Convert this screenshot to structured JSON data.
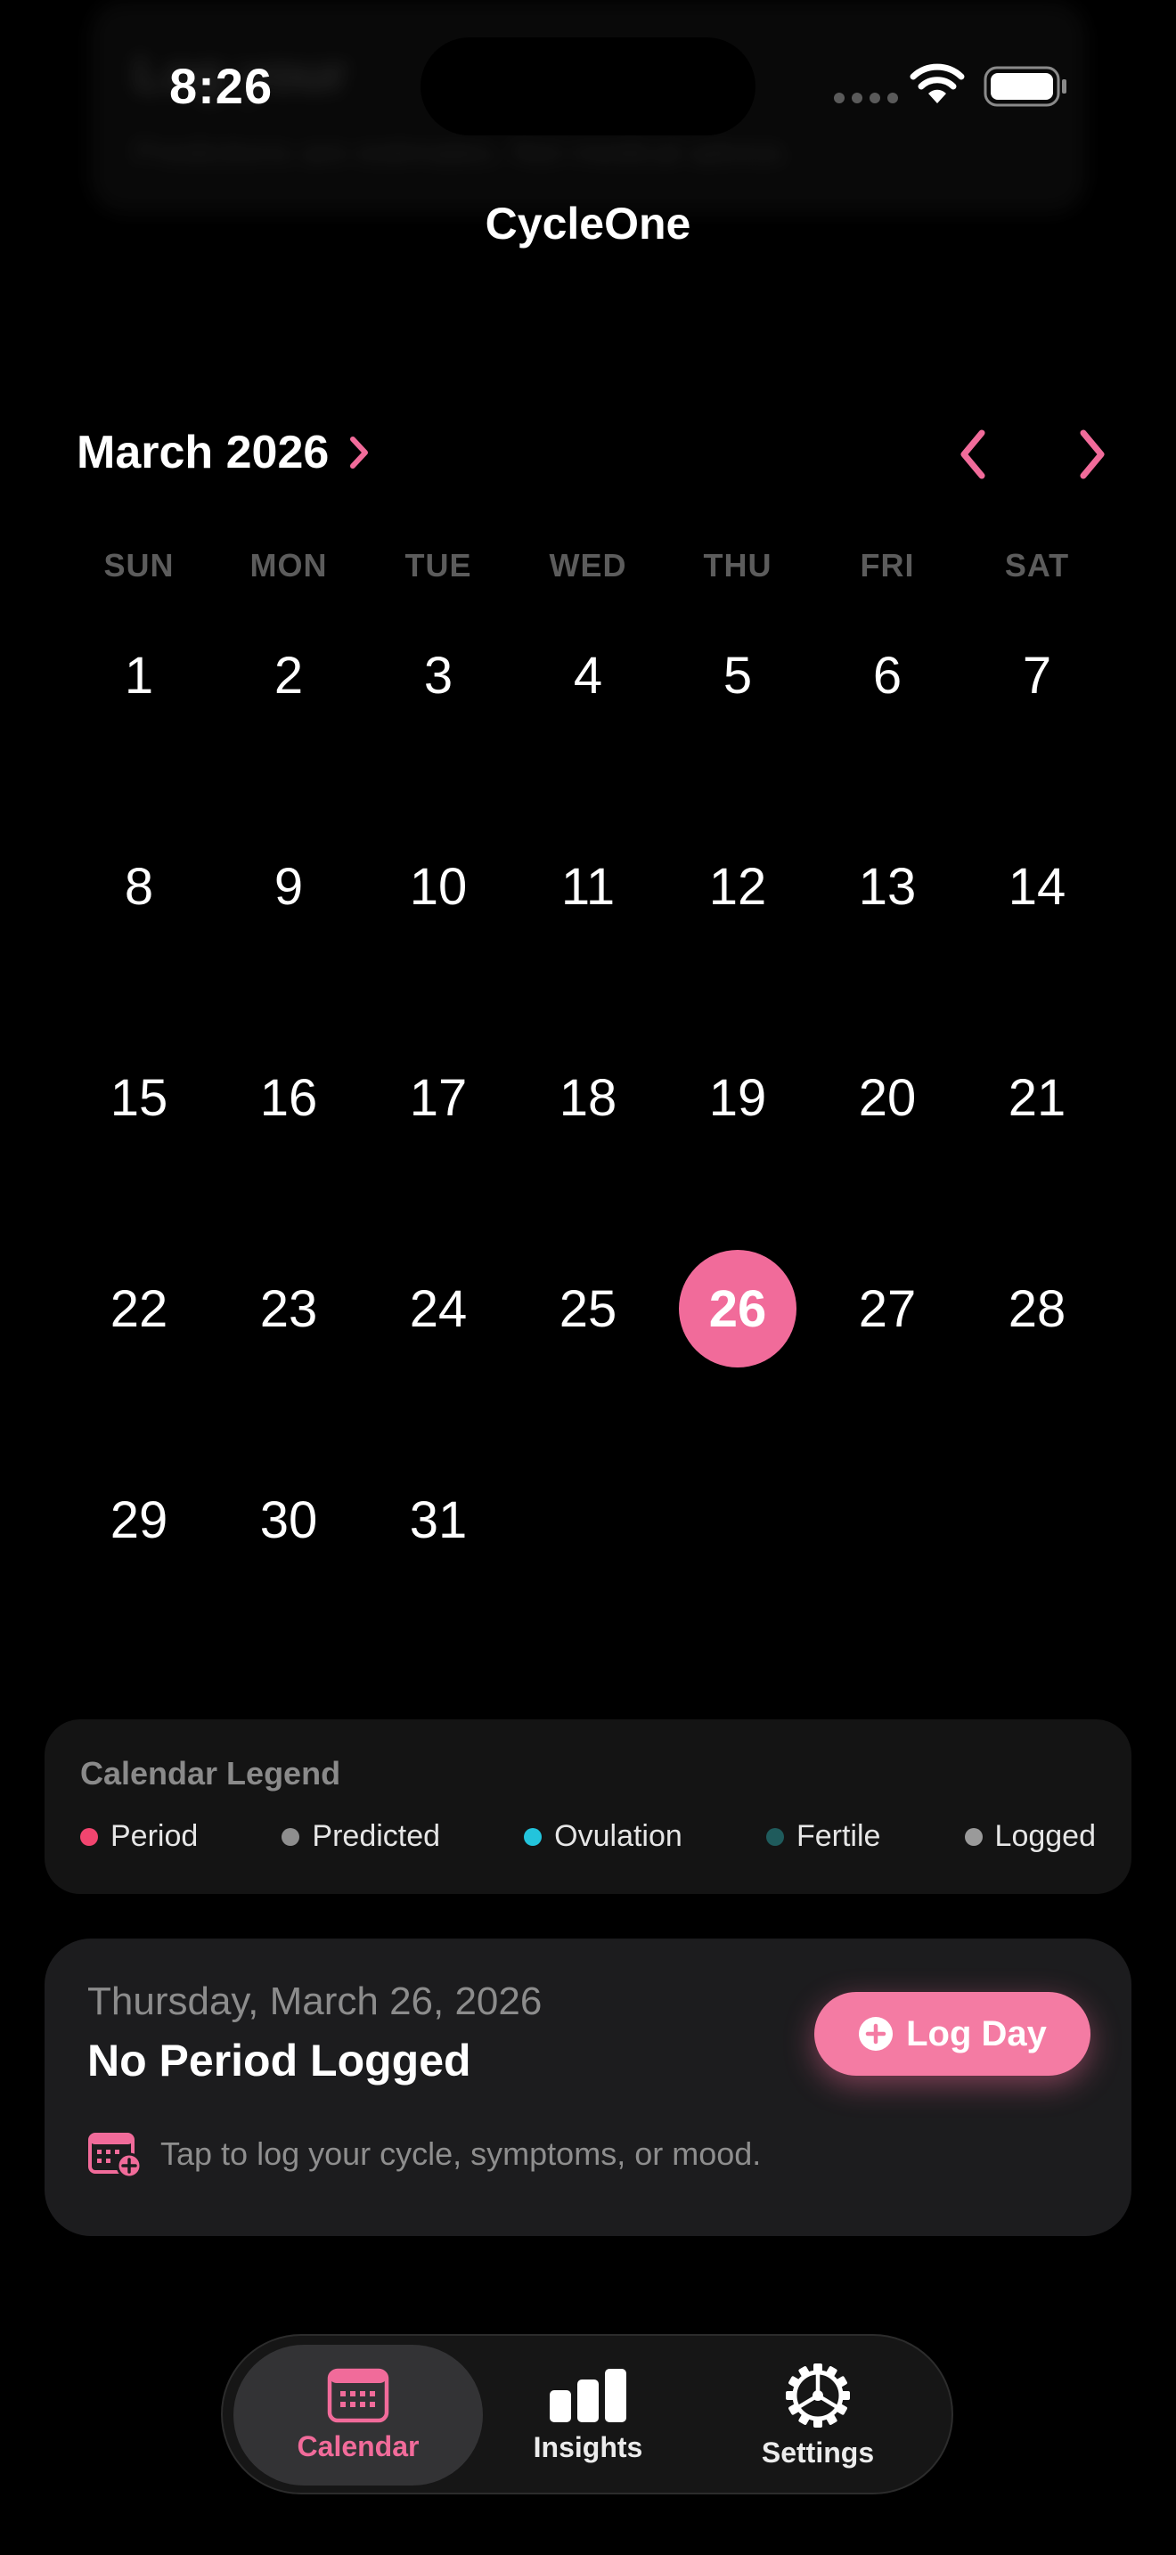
{
  "status_bar": {
    "time": "8:26"
  },
  "background_banner": {
    "title": "Log your",
    "subtitle": "Predictions are estimates. Not medical advice."
  },
  "app": {
    "title": "CycleOne"
  },
  "calendar": {
    "month_label": "March 2026",
    "weekdays": [
      "SUN",
      "MON",
      "TUE",
      "WED",
      "THU",
      "FRI",
      "SAT"
    ],
    "leading_blank_days": 0,
    "days": [
      1,
      2,
      3,
      4,
      5,
      6,
      7,
      8,
      9,
      10,
      11,
      12,
      13,
      14,
      15,
      16,
      17,
      18,
      19,
      20,
      21,
      22,
      23,
      24,
      25,
      26,
      27,
      28,
      29,
      30,
      31
    ],
    "selected_day": 26
  },
  "legend": {
    "title": "Calendar Legend",
    "items": [
      {
        "label": "Period",
        "color": "#f2456f"
      },
      {
        "label": "Predicted",
        "color": "#8e8e8e"
      },
      {
        "label": "Ovulation",
        "color": "#23c4dc"
      },
      {
        "label": "Fertile",
        "color": "#1f5b5c"
      },
      {
        "label": "Logged",
        "color": "#9a9a9a"
      }
    ]
  },
  "day_card": {
    "date": "Thursday, March 26, 2026",
    "status": "No Period Logged",
    "button_label": "Log Day",
    "hint": "Tap to log your cycle, symptoms, or mood."
  },
  "tab_bar": {
    "tabs": [
      {
        "label": "Calendar",
        "icon": "calendar-icon",
        "active": true
      },
      {
        "label": "Insights",
        "icon": "bar-chart-icon",
        "active": false
      },
      {
        "label": "Settings",
        "icon": "gear-icon",
        "active": false
      }
    ]
  },
  "colors": {
    "accent": "#f16b9a",
    "background": "#000000",
    "card": "#1c1c1e"
  }
}
